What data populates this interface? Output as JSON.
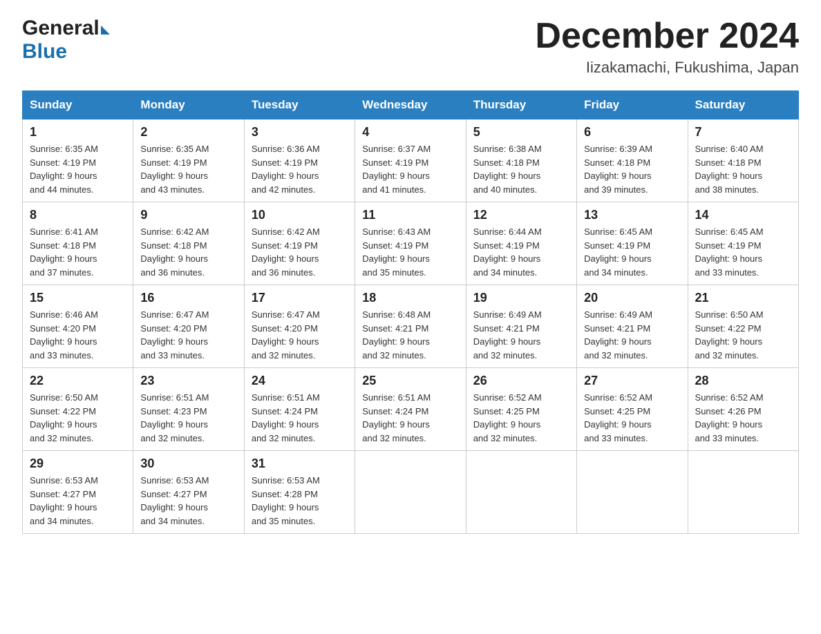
{
  "header": {
    "logo_general": "General",
    "logo_blue": "Blue",
    "month_title": "December 2024",
    "location": "Iizakamachi, Fukushima, Japan"
  },
  "weekdays": [
    "Sunday",
    "Monday",
    "Tuesday",
    "Wednesday",
    "Thursday",
    "Friday",
    "Saturday"
  ],
  "weeks": [
    [
      {
        "day": "1",
        "sunrise": "6:35 AM",
        "sunset": "4:19 PM",
        "daylight": "9 hours and 44 minutes."
      },
      {
        "day": "2",
        "sunrise": "6:35 AM",
        "sunset": "4:19 PM",
        "daylight": "9 hours and 43 minutes."
      },
      {
        "day": "3",
        "sunrise": "6:36 AM",
        "sunset": "4:19 PM",
        "daylight": "9 hours and 42 minutes."
      },
      {
        "day": "4",
        "sunrise": "6:37 AM",
        "sunset": "4:19 PM",
        "daylight": "9 hours and 41 minutes."
      },
      {
        "day": "5",
        "sunrise": "6:38 AM",
        "sunset": "4:18 PM",
        "daylight": "9 hours and 40 minutes."
      },
      {
        "day": "6",
        "sunrise": "6:39 AM",
        "sunset": "4:18 PM",
        "daylight": "9 hours and 39 minutes."
      },
      {
        "day": "7",
        "sunrise": "6:40 AM",
        "sunset": "4:18 PM",
        "daylight": "9 hours and 38 minutes."
      }
    ],
    [
      {
        "day": "8",
        "sunrise": "6:41 AM",
        "sunset": "4:18 PM",
        "daylight": "9 hours and 37 minutes."
      },
      {
        "day": "9",
        "sunrise": "6:42 AM",
        "sunset": "4:18 PM",
        "daylight": "9 hours and 36 minutes."
      },
      {
        "day": "10",
        "sunrise": "6:42 AM",
        "sunset": "4:19 PM",
        "daylight": "9 hours and 36 minutes."
      },
      {
        "day": "11",
        "sunrise": "6:43 AM",
        "sunset": "4:19 PM",
        "daylight": "9 hours and 35 minutes."
      },
      {
        "day": "12",
        "sunrise": "6:44 AM",
        "sunset": "4:19 PM",
        "daylight": "9 hours and 34 minutes."
      },
      {
        "day": "13",
        "sunrise": "6:45 AM",
        "sunset": "4:19 PM",
        "daylight": "9 hours and 34 minutes."
      },
      {
        "day": "14",
        "sunrise": "6:45 AM",
        "sunset": "4:19 PM",
        "daylight": "9 hours and 33 minutes."
      }
    ],
    [
      {
        "day": "15",
        "sunrise": "6:46 AM",
        "sunset": "4:20 PM",
        "daylight": "9 hours and 33 minutes."
      },
      {
        "day": "16",
        "sunrise": "6:47 AM",
        "sunset": "4:20 PM",
        "daylight": "9 hours and 33 minutes."
      },
      {
        "day": "17",
        "sunrise": "6:47 AM",
        "sunset": "4:20 PM",
        "daylight": "9 hours and 32 minutes."
      },
      {
        "day": "18",
        "sunrise": "6:48 AM",
        "sunset": "4:21 PM",
        "daylight": "9 hours and 32 minutes."
      },
      {
        "day": "19",
        "sunrise": "6:49 AM",
        "sunset": "4:21 PM",
        "daylight": "9 hours and 32 minutes."
      },
      {
        "day": "20",
        "sunrise": "6:49 AM",
        "sunset": "4:21 PM",
        "daylight": "9 hours and 32 minutes."
      },
      {
        "day": "21",
        "sunrise": "6:50 AM",
        "sunset": "4:22 PM",
        "daylight": "9 hours and 32 minutes."
      }
    ],
    [
      {
        "day": "22",
        "sunrise": "6:50 AM",
        "sunset": "4:22 PM",
        "daylight": "9 hours and 32 minutes."
      },
      {
        "day": "23",
        "sunrise": "6:51 AM",
        "sunset": "4:23 PM",
        "daylight": "9 hours and 32 minutes."
      },
      {
        "day": "24",
        "sunrise": "6:51 AM",
        "sunset": "4:24 PM",
        "daylight": "9 hours and 32 minutes."
      },
      {
        "day": "25",
        "sunrise": "6:51 AM",
        "sunset": "4:24 PM",
        "daylight": "9 hours and 32 minutes."
      },
      {
        "day": "26",
        "sunrise": "6:52 AM",
        "sunset": "4:25 PM",
        "daylight": "9 hours and 32 minutes."
      },
      {
        "day": "27",
        "sunrise": "6:52 AM",
        "sunset": "4:25 PM",
        "daylight": "9 hours and 33 minutes."
      },
      {
        "day": "28",
        "sunrise": "6:52 AM",
        "sunset": "4:26 PM",
        "daylight": "9 hours and 33 minutes."
      }
    ],
    [
      {
        "day": "29",
        "sunrise": "6:53 AM",
        "sunset": "4:27 PM",
        "daylight": "9 hours and 34 minutes."
      },
      {
        "day": "30",
        "sunrise": "6:53 AM",
        "sunset": "4:27 PM",
        "daylight": "9 hours and 34 minutes."
      },
      {
        "day": "31",
        "sunrise": "6:53 AM",
        "sunset": "4:28 PM",
        "daylight": "9 hours and 35 minutes."
      },
      null,
      null,
      null,
      null
    ]
  ],
  "labels": {
    "sunrise": "Sunrise:",
    "sunset": "Sunset:",
    "daylight": "Daylight:"
  }
}
